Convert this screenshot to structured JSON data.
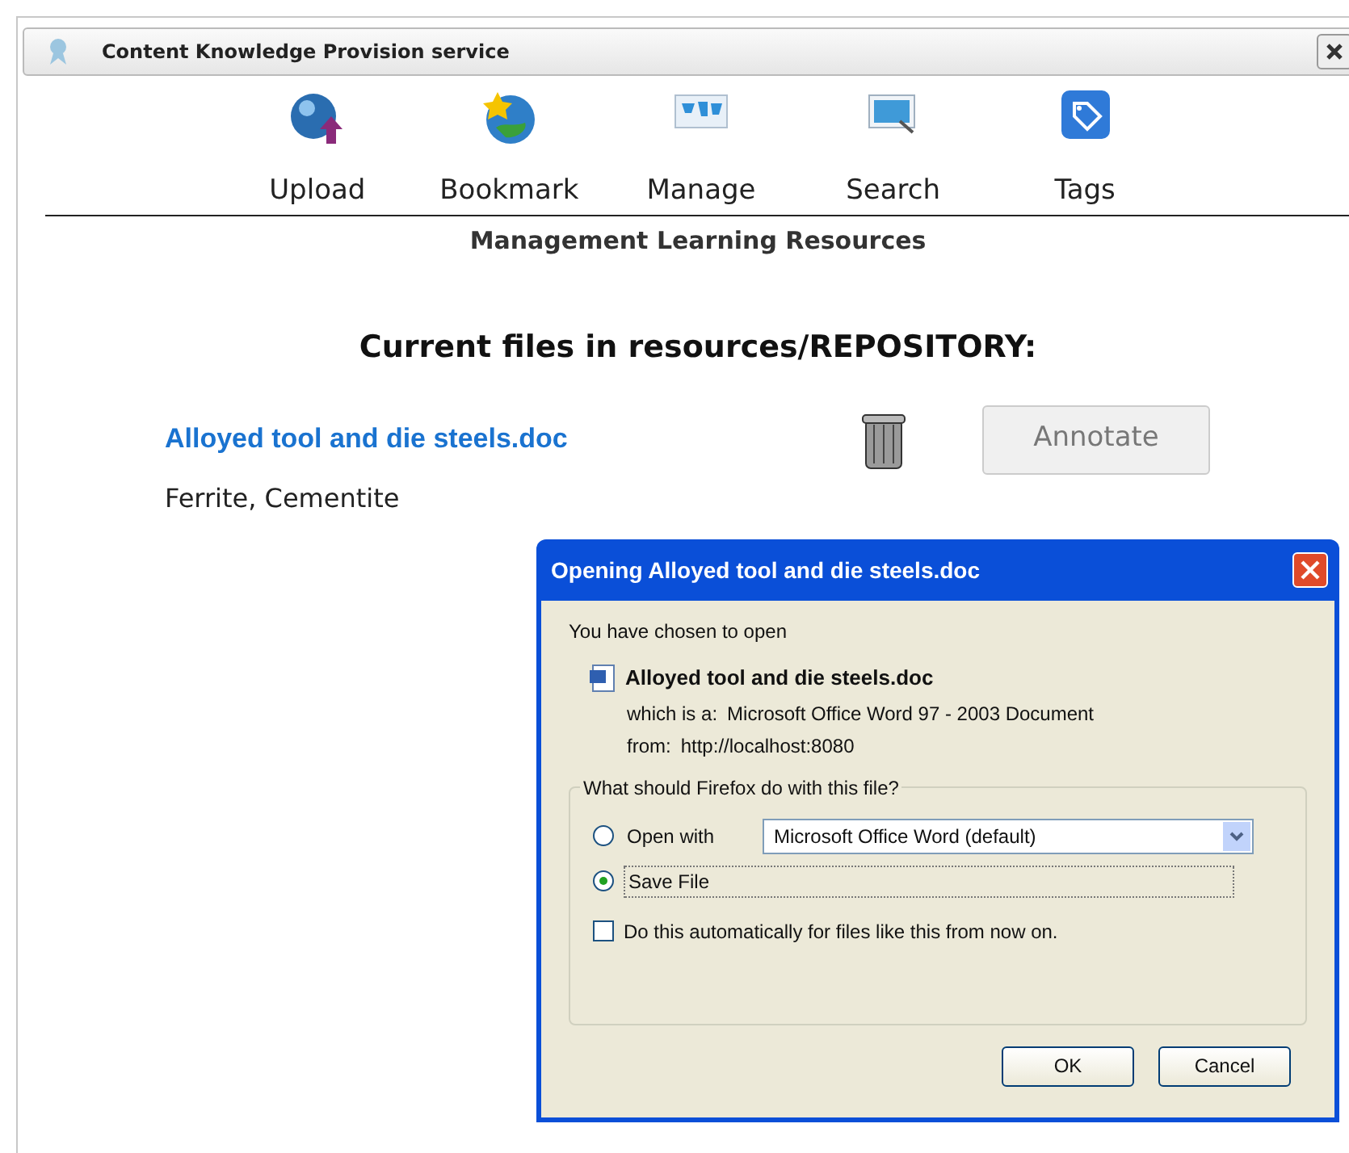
{
  "window": {
    "title": "Content Knowledge Provision service"
  },
  "toolbar": [
    {
      "label": "Upload",
      "kind": "upload"
    },
    {
      "label": "Bookmark",
      "kind": "bookmark"
    },
    {
      "label": "Manage",
      "kind": "manage"
    },
    {
      "label": "Search",
      "kind": "search"
    },
    {
      "label": "Tags",
      "kind": "tags"
    }
  ],
  "section_title": "Management Learning Resources",
  "heading": "Current files in resources/REPOSITORY:",
  "files": [
    {
      "name": "Alloyed tool and die steels.doc",
      "tags": "Ferrite, Cementite",
      "action": "Annotate",
      "disabled": true
    }
  ],
  "dialog": {
    "title": "Opening Alloyed tool and die steels.doc",
    "intro": "You have chosen to open",
    "file_name": "Alloyed tool and die steels.doc",
    "type_label": "which is a:",
    "type_value": "Microsoft Office Word 97 - 2003 Document",
    "from_label": "from:",
    "from_value": "http://localhost:8080",
    "group_label": "What should Firefox do with this file?",
    "options": [
      {
        "label": "Open with",
        "selected": false,
        "app": "Microsoft Office Word (default)"
      },
      {
        "label": "Save File",
        "selected": true
      }
    ],
    "auto": {
      "label": "Do this automatically for files like this from now on.",
      "checked": false
    },
    "buttons": [
      "OK",
      "Cancel"
    ]
  }
}
